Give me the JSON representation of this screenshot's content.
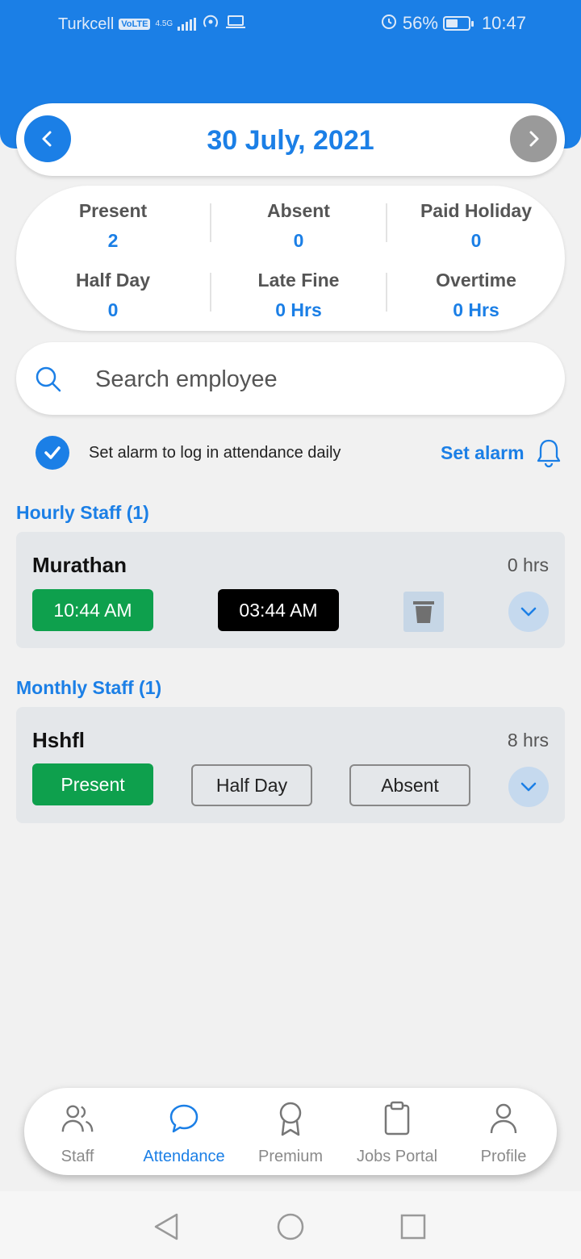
{
  "status_bar": {
    "carrier": "Turkcell",
    "volte": "VoLTE",
    "network": "4.5G",
    "battery": "56%",
    "time": "10:47"
  },
  "header": {
    "date": "30 July, 2021"
  },
  "summary": {
    "present_label": "Present",
    "present_value": "2",
    "absent_label": "Absent",
    "absent_value": "0",
    "paid_holiday_label": "Paid Holiday",
    "paid_holiday_value": "0",
    "half_day_label": "Half Day",
    "half_day_value": "0",
    "late_fine_label": "Late Fine",
    "late_fine_value": "0 Hrs",
    "overtime_label": "Overtime",
    "overtime_value": "0 Hrs"
  },
  "search": {
    "placeholder": "Search employee"
  },
  "alarm": {
    "text": "Set alarm to log in attendance daily",
    "link": "Set alarm"
  },
  "hourly": {
    "title": "Hourly Staff (1)",
    "name": "Murathan",
    "hours": "0 hrs",
    "in_time": "10:44 AM",
    "out_time": "03:44 AM"
  },
  "monthly": {
    "title": "Monthly Staff (1)",
    "name": "Hshfl",
    "hours": "8 hrs",
    "present": "Present",
    "half_day": "Half Day",
    "absent": "Absent"
  },
  "bottom_nav": {
    "items": [
      {
        "label": "Staff",
        "icon": "staff-icon"
      },
      {
        "label": "Attendance",
        "icon": "chat-icon"
      },
      {
        "label": "Premium",
        "icon": "award-icon"
      },
      {
        "label": "Jobs Portal",
        "icon": "clipboard-icon"
      },
      {
        "label": "Profile",
        "icon": "profile-icon"
      }
    ],
    "active": "Attendance"
  },
  "colors": {
    "primary": "#1b7fe6",
    "green": "#0ea04d",
    "background": "#f1f1f1"
  }
}
